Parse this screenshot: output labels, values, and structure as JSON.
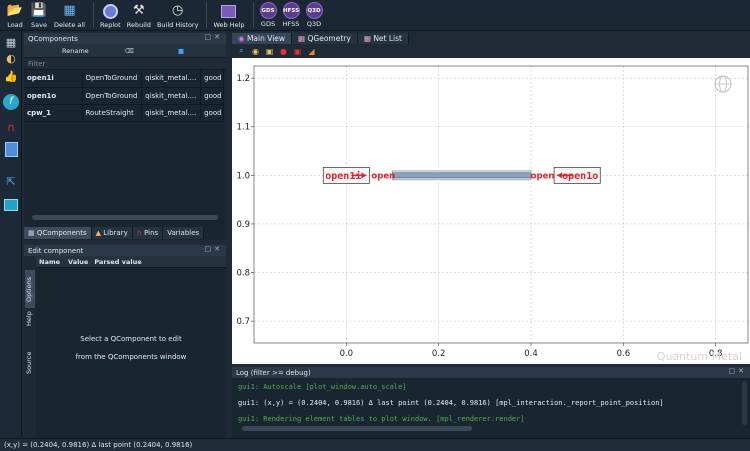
{
  "toolbar": {
    "buttons": [
      {
        "label": "Load",
        "icon": "folder-icon"
      },
      {
        "label": "Save",
        "icon": "save-icon"
      },
      {
        "label": "Delete all",
        "icon": "delete-all-icon"
      },
      {
        "label": "Replot",
        "icon": "replot-icon"
      },
      {
        "label": "Rebuild",
        "icon": "rebuild-icon"
      },
      {
        "label": "Build History",
        "icon": "history-icon"
      },
      {
        "label": "Web Help",
        "icon": "web-help-icon"
      }
    ],
    "renderers": [
      {
        "label": "GDS",
        "chip": "GDS"
      },
      {
        "label": "HFSS",
        "chip": "HFSS"
      },
      {
        "label": "Q3D",
        "chip": "Q3D"
      }
    ]
  },
  "qcomponents": {
    "title": "QComponents",
    "rename_label": "Rename",
    "filter_placeholder": "Filter",
    "rows": [
      {
        "name": "open1i",
        "class": "OpenToGround",
        "module": "qiskit_metal....",
        "status": "good"
      },
      {
        "name": "open1o",
        "class": "OpenToGround",
        "module": "qiskit_metal....",
        "status": "good"
      },
      {
        "name": "cpw_1",
        "class": "RouteStraight",
        "module": "qiskit_metal....",
        "status": "good"
      }
    ],
    "tabs": [
      "QComponents",
      "Library",
      "Pins",
      "Variables"
    ]
  },
  "edit_component": {
    "title": "Edit component",
    "columns": [
      "Name",
      "Value",
      "Parsed value"
    ],
    "vertical_tabs": [
      "Options",
      "Help",
      "Source"
    ],
    "message_line1": "Select a QComponent to edit",
    "message_line2": "from the QComponents window"
  },
  "main_view": {
    "tabs": [
      "Main View",
      "QGeometry",
      "Net List"
    ],
    "watermark": "Quantum Metal"
  },
  "chart_data": {
    "type": "scatter",
    "xlim": [
      -0.2,
      0.87
    ],
    "ylim": [
      0.655,
      1.225
    ],
    "xticks": [
      0.0,
      0.2,
      0.4,
      0.6,
      0.8
    ],
    "xtick_labels": [
      "0.0",
      "0.2",
      "0.4",
      "0.6",
      "0.8"
    ],
    "yticks": [
      0.7,
      0.8,
      0.9,
      1.0,
      1.1,
      1.2
    ],
    "ytick_labels": [
      "0.7",
      "0.8",
      "0.9",
      "1.0",
      "1.1",
      "1.2"
    ],
    "grid": true,
    "route": {
      "x0": 0.1,
      "x1": 0.4,
      "y": 1.0
    },
    "pins": [
      {
        "name": "open1i",
        "x0": -0.05,
        "x1": 0.05,
        "y": 1.0,
        "anchor": "start"
      },
      {
        "name": "open1o",
        "x0": 0.45,
        "x1": 0.55,
        "y": 1.0,
        "anchor": "end"
      }
    ],
    "pin_labels": [
      {
        "text": "open",
        "x": 0.08,
        "y": 1.0
      },
      {
        "text": "open",
        "x": 0.425,
        "y": 1.0
      }
    ],
    "colors": {
      "route": "#8aa4bc",
      "pin_label": "#e0232e",
      "outline": "#2b2b2b"
    }
  },
  "log": {
    "title": "Log  (filter >= debug)",
    "lines": [
      {
        "text": "gui1: Autoscale [plot_window.auto_scale]",
        "color": "#4fae4f"
      },
      {
        "text": "gui1: (x,y) = (0.2404, 0.9816)  Δ last point (0.2404, 0.9816) [mpl_interaction._report_point_position]",
        "color": "#e6ebf0"
      },
      {
        "text": "gui1: Rendering element tables to plot window. [mpl_renderer.render]",
        "color": "#4fae4f"
      }
    ]
  },
  "status": "(x,y) = (0.2404, 0.9816)  Δ last point (0.2404, 0.9816)"
}
